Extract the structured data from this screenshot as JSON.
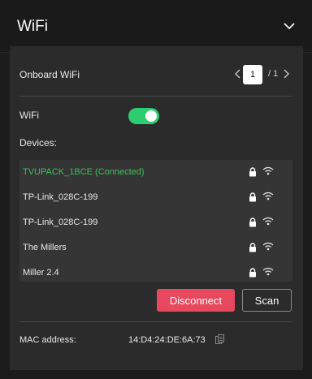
{
  "header": {
    "title": "WiFi",
    "collapse_icon": "chevron-down-icon"
  },
  "onboard": {
    "label": "Onboard WiFi",
    "current_page": "1",
    "total_pages": "/ 1"
  },
  "wifi": {
    "label": "WiFi",
    "enabled": true
  },
  "devices": {
    "label": "Devices:",
    "items": [
      {
        "name": "TVUPACK_1BCE (Connected)",
        "connected": true,
        "locked": true
      },
      {
        "name": "TP-Link_028C-199",
        "connected": false,
        "locked": true
      },
      {
        "name": "TP-Link_028C-199",
        "connected": false,
        "locked": true
      },
      {
        "name": "The Millers",
        "connected": false,
        "locked": true
      },
      {
        "name": "Miller 2.4",
        "connected": false,
        "locked": true
      }
    ]
  },
  "actions": {
    "disconnect_label": "Disconnect",
    "scan_label": "Scan"
  },
  "mac": {
    "label": "MAC address:",
    "value": "14:D4:24:DE:6A:73"
  },
  "colors": {
    "accent_green": "#2ecc71",
    "connected_text": "#3dbd5a",
    "disconnect_bg": "#e8485e"
  }
}
